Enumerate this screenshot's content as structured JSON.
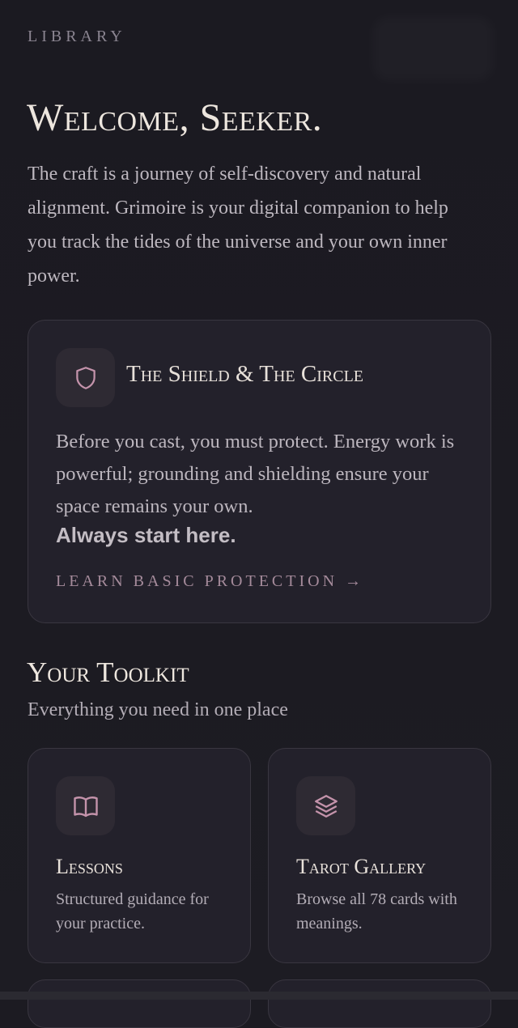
{
  "header": {
    "eyebrow": "LIBRARY"
  },
  "hero": {
    "title": "Welcome, Seeker.",
    "intro": "The craft is a journey of self-discovery and natural alignment. Grimoire is your digital companion to help you track the tides of the universe and your own inner power."
  },
  "protection_card": {
    "icon": "shield-icon",
    "title": "The Shield & The Circle",
    "body": "Before you cast, you must protect. Energy work is powerful; grounding and shielding ensure your space remains your own.",
    "emphasis": "Always start here.",
    "link_label": "LEARN BASIC PROTECTION →"
  },
  "toolkit": {
    "title": "Your Toolkit",
    "subtitle": "Everything you need in one place",
    "items": [
      {
        "icon": "open-book-icon",
        "title": "Lessons",
        "description": "Structured guidance for your practice."
      },
      {
        "icon": "layers-icon",
        "title": "Tarot Gallery",
        "description": "Browse all 78 cards with meanings."
      }
    ]
  },
  "colors": {
    "background": "#1c1b22",
    "card": "#23212b",
    "accent": "#b58a9f",
    "heading": "#ede6de",
    "body_text": "#bcb6be"
  }
}
